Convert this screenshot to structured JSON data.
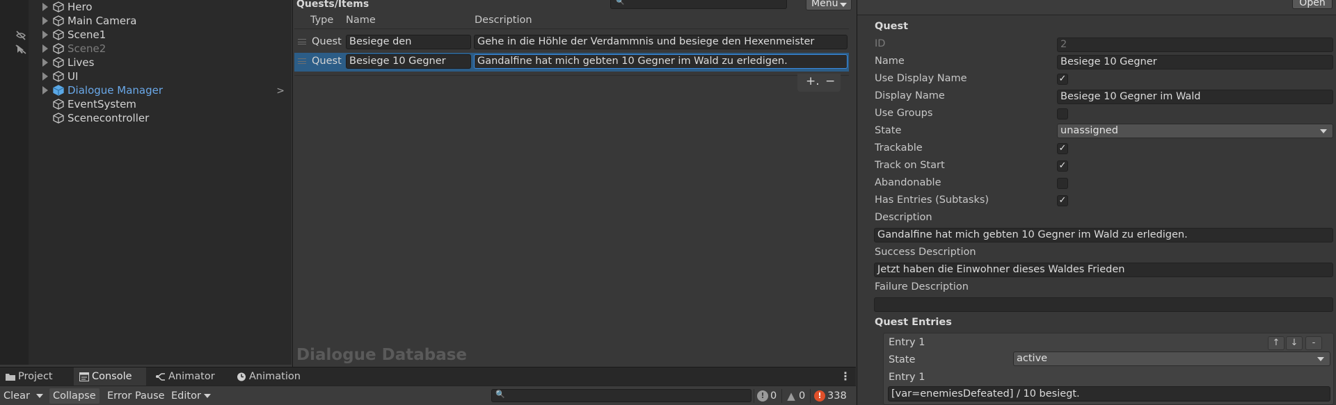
{
  "hierarchy": {
    "items": [
      {
        "label": "Hero",
        "state": "normal",
        "has_arrow": true
      },
      {
        "label": "Main Camera",
        "state": "normal",
        "has_arrow": true
      },
      {
        "label": "Scene1",
        "state": "normal",
        "has_arrow": true
      },
      {
        "label": "Scene2",
        "state": "dim",
        "has_arrow": true
      },
      {
        "label": "Lives",
        "state": "normal",
        "has_arrow": true
      },
      {
        "label": "UI",
        "state": "normal",
        "has_arrow": true
      },
      {
        "label": "Dialogue Manager",
        "state": "selected",
        "has_arrow": true
      },
      {
        "label": "EventSystem",
        "state": "normal",
        "has_arrow": false
      },
      {
        "label": "Scenecontroller",
        "state": "normal",
        "has_arrow": false
      }
    ],
    "chevron": ">"
  },
  "database": {
    "title": "Quests/Items",
    "menu_label": "Menu",
    "columns": {
      "type": "Type",
      "name": "Name",
      "description": "Description"
    },
    "rows": [
      {
        "type": "Quest",
        "name": "Besiege den",
        "description": "Gehe in die Höhle der Verdammnis und besiege den Hexenmeister",
        "selected": false
      },
      {
        "type": "Quest",
        "name": "Besiege 10 Gegner",
        "description": "Gandalfine hat mich gebten 10 Gegner im Wald zu erledigen.",
        "selected": true
      }
    ],
    "add_label": "+.",
    "remove_label": "−",
    "watermark": "Dialogue Database"
  },
  "inspector": {
    "open_label": "Open",
    "section_title": "Quest",
    "id_label": "ID",
    "id_value": "2",
    "name_label": "Name",
    "name_value": "Besiege 10 Gegner",
    "use_display_name_label": "Use Display Name",
    "use_display_name_checked": true,
    "display_name_label": "Display Name",
    "display_name_value": "Besiege 10 Gegner im Wald",
    "use_groups_label": "Use Groups",
    "use_groups_checked": false,
    "state_label": "State",
    "state_value": "unassigned",
    "trackable_label": "Trackable",
    "trackable_checked": true,
    "track_on_start_label": "Track on Start",
    "track_on_start_checked": true,
    "abandonable_label": "Abandonable",
    "abandonable_checked": false,
    "has_entries_label": "Has Entries (Subtasks)",
    "has_entries_checked": true,
    "description_label": "Description",
    "description_value": "Gandalfine hat mich gebten 10 Gegner im Wald zu erledigen.",
    "success_label": "Success Description",
    "success_value": "Jetzt haben die Einwohner dieses Waldes Frieden",
    "failure_label": "Failure Description",
    "failure_value": "",
    "entries_title": "Quest Entries",
    "entry": {
      "header": "Entry 1",
      "state_label": "State",
      "state_value": "active",
      "text_label": "Entry 1",
      "text_value": "[var=enemiesDefeated] / 10 besiegt.",
      "up": "↑",
      "down": "↓",
      "remove": "-"
    },
    "check_mark": "✓"
  },
  "bottom_tabs": [
    {
      "label": "Project",
      "icon": "folder-icon",
      "active": false
    },
    {
      "label": "Console",
      "icon": "console-icon",
      "active": true
    },
    {
      "label": "Animator",
      "icon": "animator-icon",
      "active": false
    },
    {
      "label": "Animation",
      "icon": "clock-icon",
      "active": false
    }
  ],
  "console": {
    "clear_label": "Clear",
    "collapse_label": "Collapse",
    "error_pause_label": "Error Pause",
    "editor_label": "Editor",
    "info_count": "0",
    "warning_count": "0",
    "error_count": "338"
  },
  "colors": {
    "accent": "#4a8ae0",
    "selection": "#2c5d87",
    "error": "#e0502a"
  }
}
